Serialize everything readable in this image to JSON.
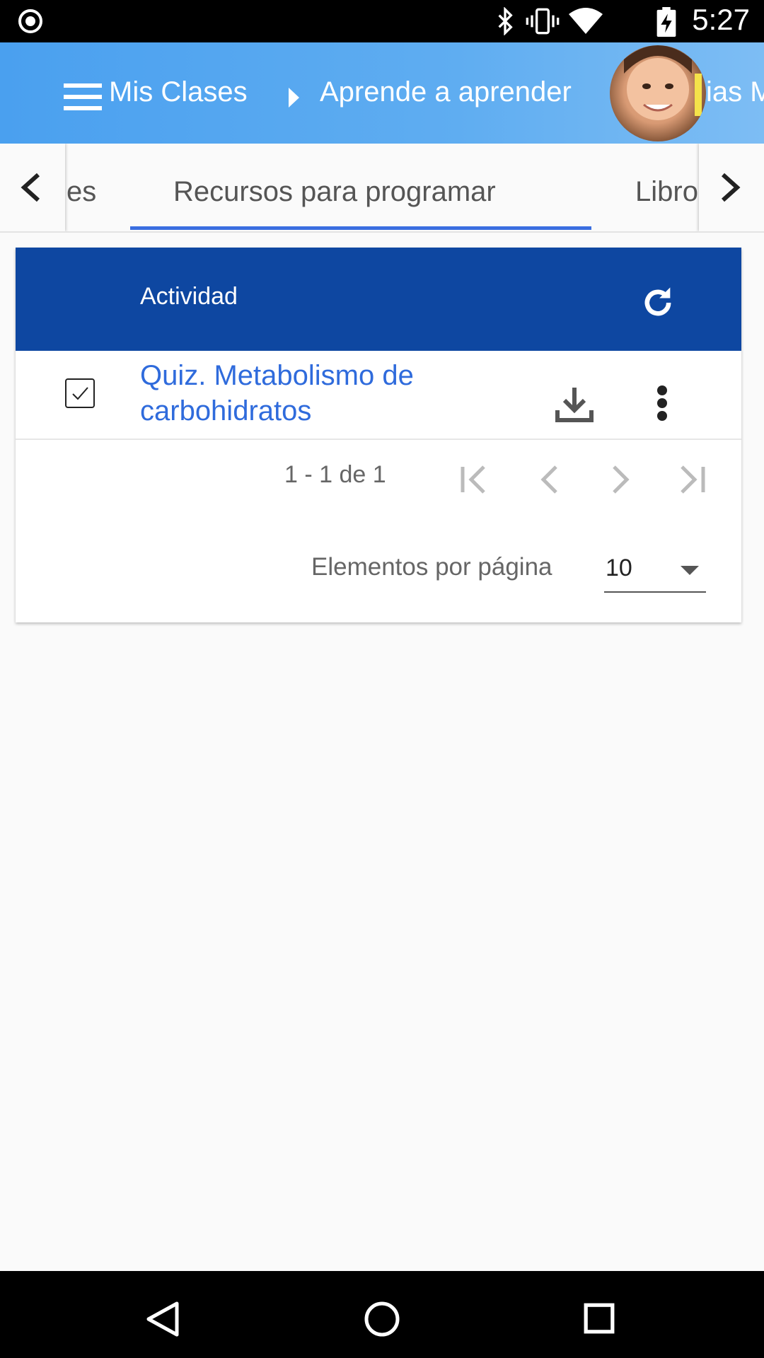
{
  "status_bar": {
    "time": "5:27",
    "icons": [
      "screen-record-icon",
      "bluetooth-icon",
      "vibrate-icon",
      "wifi-icon",
      "battery-charging-icon"
    ]
  },
  "app_bar": {
    "breadcrumb": [
      "Mis Clases",
      "Aprende a aprender",
      "ias M"
    ],
    "menu_icon": "hamburger-menu-icon",
    "avatar": "user-avatar"
  },
  "tabs": {
    "items": [
      "es",
      "Recursos para programar",
      "Libro"
    ],
    "active": "Recursos para programar"
  },
  "table": {
    "header": "Actividad",
    "rows": [
      {
        "title": "Quiz. Metabolismo de carbohidratos",
        "checked": true
      }
    ],
    "pagination": {
      "range": "1 - 1 de 1",
      "per_page_label": "Elementos por página",
      "per_page_value": "10"
    }
  },
  "colors": {
    "app_bar": "#5aa8f0",
    "table_header": "#0e47a1",
    "link": "#2f6bdc",
    "tab_indicator": "#3a6ee0"
  }
}
